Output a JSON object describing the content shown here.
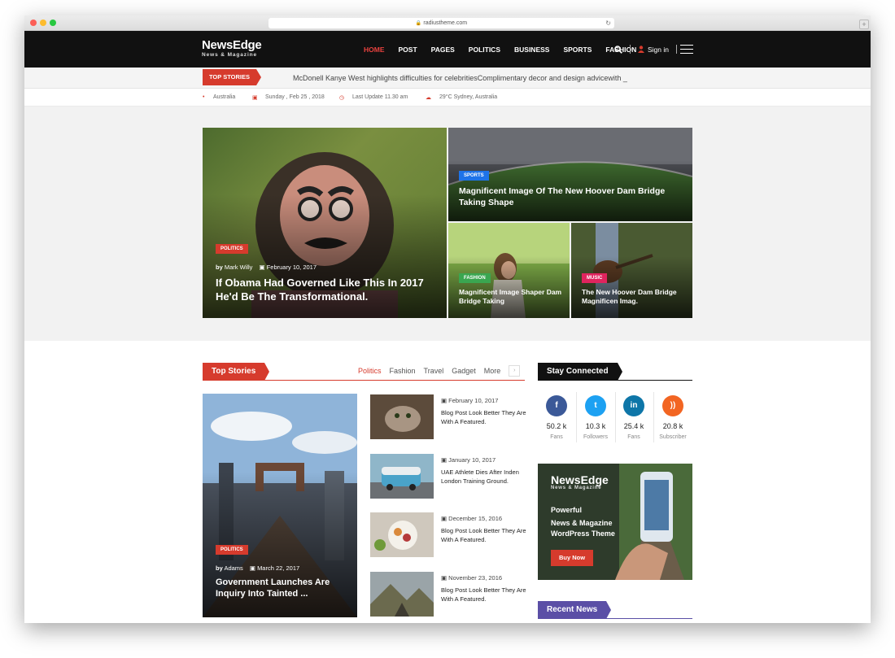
{
  "browser": {
    "url": "radiustheme.com"
  },
  "brand": {
    "logo_line1": "NewsEdge",
    "logo_line2": "News & Magazine"
  },
  "nav": {
    "items": [
      {
        "label": "HOME",
        "active": true
      },
      {
        "label": "POST",
        "active": false
      },
      {
        "label": "PAGES",
        "active": false
      },
      {
        "label": "POLITICS",
        "active": false
      },
      {
        "label": "BUSINESS",
        "active": false
      },
      {
        "label": "SPORTS",
        "active": false
      },
      {
        "label": "FASHION",
        "active": false
      }
    ],
    "signin": "Sign in"
  },
  "ticker": {
    "label": "TOP STORIES",
    "text": "McDonell Kanye West highlights difficulties for celebritiesComplimentary decor and design advicewith _"
  },
  "info": {
    "location": "Australia",
    "date": "Sunday , Feb 25 , 2018",
    "last_update": "Last Update 11.30 am",
    "weather": "29°C Sydney, Australia"
  },
  "hero": {
    "main": {
      "tag": "POLITICS",
      "by": "by",
      "author": "Mark Willy",
      "date": "February 10, 2017",
      "title": "If Obama Had Governed Like This In 2017 He'd Be The Transformational."
    },
    "top_right": {
      "tag": "SPORTS",
      "title": "Magnificent Image Of The New Hoover Dam Bridge Taking Shape"
    },
    "bottom_left": {
      "tag": "FASHION",
      "title": "Magnificent Image Shaper Dam Bridge Taking"
    },
    "bottom_right": {
      "tag": "MUSIC",
      "title": "The New Hoover Dam Bridge Magnificen Imag."
    }
  },
  "top_stories": {
    "label": "Top Stories",
    "tabs": [
      "Politics",
      "Fashion",
      "Travel",
      "Gadget",
      "More"
    ],
    "feature": {
      "tag": "POLITICS",
      "by": "by",
      "author": "Adams",
      "date": "March 22, 2017",
      "title": "Government Launches Are Inquiry Into Tainted ..."
    },
    "list": [
      {
        "date": "February 10, 2017",
        "title": "Blog Post Look Better They Are With A Featured."
      },
      {
        "date": "January 10, 2017",
        "title": "UAE Athlete Dies After Inden London Training Ground."
      },
      {
        "date": "December 15, 2016",
        "title": "Blog Post Look Better They Are With A Featured."
      },
      {
        "date": "November 23, 2016",
        "title": "Blog Post Look Better They Are With A Featured."
      }
    ]
  },
  "stay_connected": {
    "label": "Stay Connected",
    "items": [
      {
        "icon": "facebook-icon",
        "glyph": "f",
        "count": "50.2 k",
        "label": "Fans",
        "color": "#3b5998"
      },
      {
        "icon": "twitter-icon",
        "glyph": "t",
        "count": "10.3 k",
        "label": "Followers",
        "color": "#1da1f2"
      },
      {
        "icon": "linkedin-icon",
        "glyph": "in",
        "count": "25.4 k",
        "label": "Fans",
        "color": "#0e76a8"
      },
      {
        "icon": "rss-icon",
        "glyph": "))",
        "count": "20.8 k",
        "label": "Subscriber",
        "color": "#f26522"
      }
    ]
  },
  "ad": {
    "logo_line1": "NewsEdge",
    "logo_line2": "News & Magazine",
    "line1": "Powerful",
    "line2": "News & Magazine",
    "line3": "WordPress Theme",
    "button": "Buy Now"
  },
  "recent_news": {
    "label": "Recent News"
  },
  "colors": {
    "accent": "#d63b2d",
    "nav_bg": "#111111",
    "sports": "#1e73e8",
    "fashion": "#3aa650",
    "music": "#e0245e",
    "recent": "#5b4fa6"
  }
}
